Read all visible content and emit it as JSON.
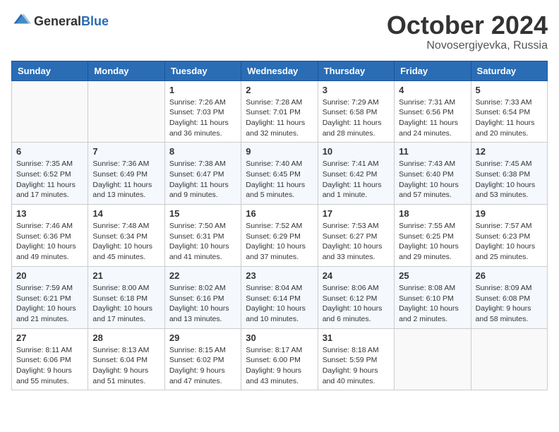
{
  "logo": {
    "text_general": "General",
    "text_blue": "Blue"
  },
  "title": "October 2024",
  "location": "Novosergiyevka, Russia",
  "weekdays": [
    "Sunday",
    "Monday",
    "Tuesday",
    "Wednesday",
    "Thursday",
    "Friday",
    "Saturday"
  ],
  "weeks": [
    [
      {
        "day": "",
        "info": ""
      },
      {
        "day": "",
        "info": ""
      },
      {
        "day": "1",
        "info": "Sunrise: 7:26 AM\nSunset: 7:03 PM\nDaylight: 11 hours\nand 36 minutes."
      },
      {
        "day": "2",
        "info": "Sunrise: 7:28 AM\nSunset: 7:01 PM\nDaylight: 11 hours\nand 32 minutes."
      },
      {
        "day": "3",
        "info": "Sunrise: 7:29 AM\nSunset: 6:58 PM\nDaylight: 11 hours\nand 28 minutes."
      },
      {
        "day": "4",
        "info": "Sunrise: 7:31 AM\nSunset: 6:56 PM\nDaylight: 11 hours\nand 24 minutes."
      },
      {
        "day": "5",
        "info": "Sunrise: 7:33 AM\nSunset: 6:54 PM\nDaylight: 11 hours\nand 20 minutes."
      }
    ],
    [
      {
        "day": "6",
        "info": "Sunrise: 7:35 AM\nSunset: 6:52 PM\nDaylight: 11 hours\nand 17 minutes."
      },
      {
        "day": "7",
        "info": "Sunrise: 7:36 AM\nSunset: 6:49 PM\nDaylight: 11 hours\nand 13 minutes."
      },
      {
        "day": "8",
        "info": "Sunrise: 7:38 AM\nSunset: 6:47 PM\nDaylight: 11 hours\nand 9 minutes."
      },
      {
        "day": "9",
        "info": "Sunrise: 7:40 AM\nSunset: 6:45 PM\nDaylight: 11 hours\nand 5 minutes."
      },
      {
        "day": "10",
        "info": "Sunrise: 7:41 AM\nSunset: 6:42 PM\nDaylight: 11 hours\nand 1 minute."
      },
      {
        "day": "11",
        "info": "Sunrise: 7:43 AM\nSunset: 6:40 PM\nDaylight: 10 hours\nand 57 minutes."
      },
      {
        "day": "12",
        "info": "Sunrise: 7:45 AM\nSunset: 6:38 PM\nDaylight: 10 hours\nand 53 minutes."
      }
    ],
    [
      {
        "day": "13",
        "info": "Sunrise: 7:46 AM\nSunset: 6:36 PM\nDaylight: 10 hours\nand 49 minutes."
      },
      {
        "day": "14",
        "info": "Sunrise: 7:48 AM\nSunset: 6:34 PM\nDaylight: 10 hours\nand 45 minutes."
      },
      {
        "day": "15",
        "info": "Sunrise: 7:50 AM\nSunset: 6:31 PM\nDaylight: 10 hours\nand 41 minutes."
      },
      {
        "day": "16",
        "info": "Sunrise: 7:52 AM\nSunset: 6:29 PM\nDaylight: 10 hours\nand 37 minutes."
      },
      {
        "day": "17",
        "info": "Sunrise: 7:53 AM\nSunset: 6:27 PM\nDaylight: 10 hours\nand 33 minutes."
      },
      {
        "day": "18",
        "info": "Sunrise: 7:55 AM\nSunset: 6:25 PM\nDaylight: 10 hours\nand 29 minutes."
      },
      {
        "day": "19",
        "info": "Sunrise: 7:57 AM\nSunset: 6:23 PM\nDaylight: 10 hours\nand 25 minutes."
      }
    ],
    [
      {
        "day": "20",
        "info": "Sunrise: 7:59 AM\nSunset: 6:21 PM\nDaylight: 10 hours\nand 21 minutes."
      },
      {
        "day": "21",
        "info": "Sunrise: 8:00 AM\nSunset: 6:18 PM\nDaylight: 10 hours\nand 17 minutes."
      },
      {
        "day": "22",
        "info": "Sunrise: 8:02 AM\nSunset: 6:16 PM\nDaylight: 10 hours\nand 13 minutes."
      },
      {
        "day": "23",
        "info": "Sunrise: 8:04 AM\nSunset: 6:14 PM\nDaylight: 10 hours\nand 10 minutes."
      },
      {
        "day": "24",
        "info": "Sunrise: 8:06 AM\nSunset: 6:12 PM\nDaylight: 10 hours\nand 6 minutes."
      },
      {
        "day": "25",
        "info": "Sunrise: 8:08 AM\nSunset: 6:10 PM\nDaylight: 10 hours\nand 2 minutes."
      },
      {
        "day": "26",
        "info": "Sunrise: 8:09 AM\nSunset: 6:08 PM\nDaylight: 9 hours\nand 58 minutes."
      }
    ],
    [
      {
        "day": "27",
        "info": "Sunrise: 8:11 AM\nSunset: 6:06 PM\nDaylight: 9 hours\nand 55 minutes."
      },
      {
        "day": "28",
        "info": "Sunrise: 8:13 AM\nSunset: 6:04 PM\nDaylight: 9 hours\nand 51 minutes."
      },
      {
        "day": "29",
        "info": "Sunrise: 8:15 AM\nSunset: 6:02 PM\nDaylight: 9 hours\nand 47 minutes."
      },
      {
        "day": "30",
        "info": "Sunrise: 8:17 AM\nSunset: 6:00 PM\nDaylight: 9 hours\nand 43 minutes."
      },
      {
        "day": "31",
        "info": "Sunrise: 8:18 AM\nSunset: 5:59 PM\nDaylight: 9 hours\nand 40 minutes."
      },
      {
        "day": "",
        "info": ""
      },
      {
        "day": "",
        "info": ""
      }
    ]
  ]
}
